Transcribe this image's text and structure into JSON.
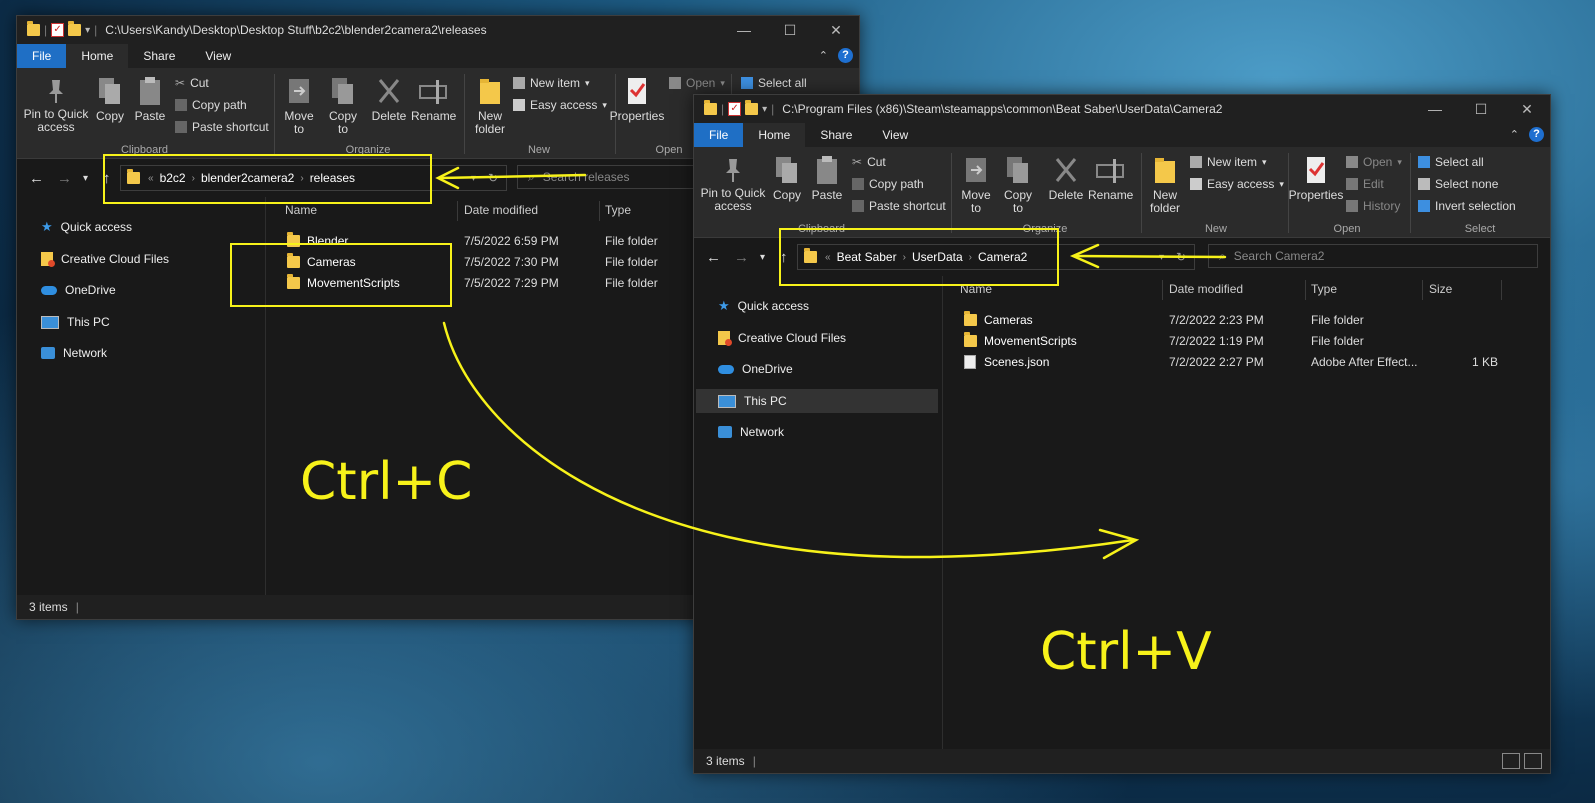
{
  "left": {
    "title_path": "C:\\Users\\Kandy\\Desktop\\Desktop Stuff\\b2c2\\blender2camera2\\releases",
    "tabs": [
      "File",
      "Home",
      "Share",
      "View"
    ],
    "ribbon": {
      "pin": "Pin to Quick access",
      "copy": "Copy",
      "paste": "Paste",
      "cut": "Cut",
      "copy_path": "Copy path",
      "paste_shortcut": "Paste shortcut",
      "clipboard": "Clipboard",
      "move_to": "Move to",
      "copy_to": "Copy to",
      "delete": "Delete",
      "rename": "Rename",
      "organize": "Organize",
      "new_folder": "New folder",
      "new_item": "New item",
      "easy_access": "Easy access",
      "new": "New",
      "properties": "Properties",
      "open": "Open",
      "open_group": "Open",
      "select_all": "Select all"
    },
    "crumbs": [
      "b2c2",
      "blender2camera2",
      "releases"
    ],
    "search_placeholder": "Search releases",
    "nav": [
      "Quick access",
      "Creative Cloud Files",
      "OneDrive",
      "This PC",
      "Network"
    ],
    "columns": [
      "Name",
      "Date modified",
      "Type"
    ],
    "files": [
      {
        "name": "Blender",
        "date": "7/5/2022 6:59 PM",
        "type": "File folder"
      },
      {
        "name": "Cameras",
        "date": "7/5/2022 7:30 PM",
        "type": "File folder"
      },
      {
        "name": "MovementScripts",
        "date": "7/5/2022 7:29 PM",
        "type": "File folder"
      }
    ],
    "status": "3 items"
  },
  "right": {
    "title_path": "C:\\Program Files (x86)\\Steam\\steamapps\\common\\Beat Saber\\UserData\\Camera2",
    "tabs": [
      "File",
      "Home",
      "Share",
      "View"
    ],
    "ribbon": {
      "pin": "Pin to Quick access",
      "copy": "Copy",
      "paste": "Paste",
      "cut": "Cut",
      "copy_path": "Copy path",
      "paste_shortcut": "Paste shortcut",
      "clipboard": "Clipboard",
      "move_to": "Move to",
      "copy_to": "Copy to",
      "delete": "Delete",
      "rename": "Rename",
      "organize": "Organize",
      "new_folder": "New folder",
      "new_item": "New item",
      "easy_access": "Easy access",
      "new": "New",
      "properties": "Properties",
      "open": "Open",
      "edit": "Edit",
      "history": "History",
      "open_group": "Open",
      "select_all": "Select all",
      "select_none": "Select none",
      "invert_selection": "Invert selection",
      "select_group": "Select"
    },
    "crumbs": [
      "Beat Saber",
      "UserData",
      "Camera2"
    ],
    "search_placeholder": "Search Camera2",
    "nav": [
      "Quick access",
      "Creative Cloud Files",
      "OneDrive",
      "This PC",
      "Network"
    ],
    "columns": [
      "Name",
      "Date modified",
      "Type",
      "Size"
    ],
    "files": [
      {
        "name": "Cameras",
        "date": "7/2/2022 2:23 PM",
        "type": "File folder",
        "size": ""
      },
      {
        "name": "MovementScripts",
        "date": "7/2/2022 1:19 PM",
        "type": "File folder",
        "size": ""
      },
      {
        "name": "Scenes.json",
        "date": "7/2/2022 2:27 PM",
        "type": "Adobe After Effect...",
        "size": "1 KB"
      }
    ],
    "status": "3 items"
  },
  "annotations": {
    "copy_text": "Ctrl+C",
    "paste_text": "Ctrl+V",
    "color": "#f7f21a"
  }
}
